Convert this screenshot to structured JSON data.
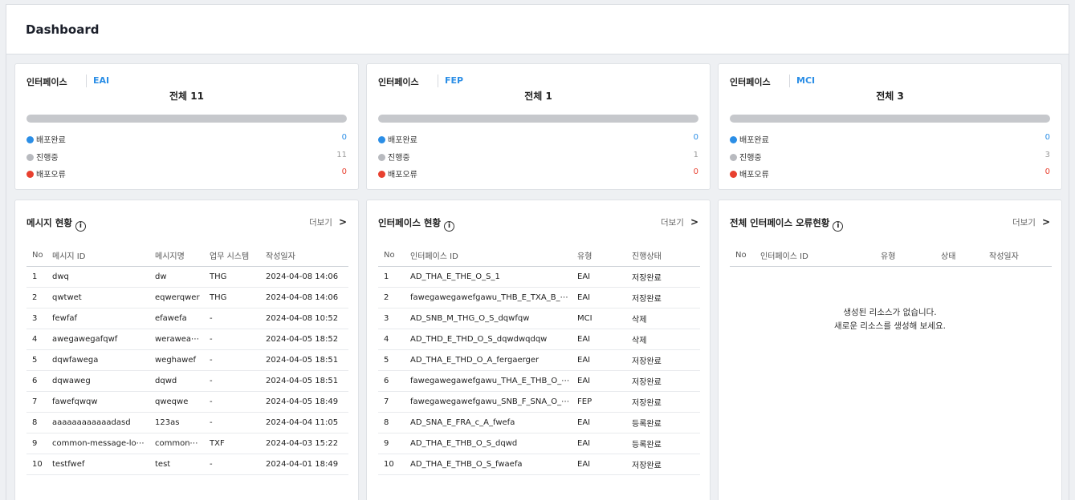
{
  "header": {
    "title": "Dashboard"
  },
  "summary_cards": [
    {
      "label": "인터페이스",
      "type": "EAI",
      "total": "전체 11",
      "rows": [
        {
          "label": "배포완료",
          "value": "0"
        },
        {
          "label": "진행중",
          "value": "11"
        },
        {
          "label": "배포오류",
          "value": "0"
        }
      ]
    },
    {
      "label": "인터페이스",
      "type": "FEP",
      "total": "전체 1",
      "rows": [
        {
          "label": "배포완료",
          "value": "0"
        },
        {
          "label": "진행중",
          "value": "1"
        },
        {
          "label": "배포오류",
          "value": "0"
        }
      ]
    },
    {
      "label": "인터페이스",
      "type": "MCI",
      "total": "전체 3",
      "rows": [
        {
          "label": "배포완료",
          "value": "0"
        },
        {
          "label": "진행중",
          "value": "3"
        },
        {
          "label": "배포오류",
          "value": "0"
        }
      ]
    }
  ],
  "colors": {
    "accent": "#2b8ee6",
    "progress": "#b8babf",
    "error": "#e8402f"
  },
  "message_panel": {
    "title": "메시지 현황",
    "more": "더보기",
    "columns": [
      "No",
      "메시지 ID",
      "메시지명",
      "업무 시스템",
      "작성일자"
    ],
    "rows": [
      [
        "1",
        "dwq",
        "dw",
        "THG",
        "2024-04-08 14:06"
      ],
      [
        "2",
        "qwtwet",
        "eqwerqwer",
        "THG",
        "2024-04-08 14:06"
      ],
      [
        "3",
        "fewfaf",
        "efawefa",
        "-",
        "2024-04-08 10:52"
      ],
      [
        "4",
        "awegawegafqwf",
        "werawea⋯",
        "-",
        "2024-04-05 18:52"
      ],
      [
        "5",
        "dqwfawega",
        "weghawef",
        "-",
        "2024-04-05 18:51"
      ],
      [
        "6",
        "dqwaweg",
        "dqwd",
        "-",
        "2024-04-05 18:51"
      ],
      [
        "7",
        "fawefqwqw",
        "qweqwe",
        "-",
        "2024-04-05 18:49"
      ],
      [
        "8",
        "aaaaaaaaaaaadasd",
        "123as",
        "-",
        "2024-04-04 11:05"
      ],
      [
        "9",
        "common-message-lo⋯",
        "common⋯",
        "TXF",
        "2024-04-03 15:22"
      ],
      [
        "10",
        "testfwef",
        "test",
        "-",
        "2024-04-01 18:49"
      ]
    ]
  },
  "interface_panel": {
    "title": "인터페이스 현황",
    "more": "더보기",
    "columns": [
      "No",
      "인터페이스 ID",
      "유형",
      "진행상태"
    ],
    "rows": [
      [
        "1",
        "AD_THA_E_THE_O_S_1",
        "EAI",
        "저장완료"
      ],
      [
        "2",
        "fawegawegawefgawu_THB_E_TXA_B_⋯",
        "EAI",
        "저장완료"
      ],
      [
        "3",
        "AD_SNB_M_THG_O_S_dqwfqw",
        "MCI",
        "삭제"
      ],
      [
        "4",
        "AD_THD_E_THD_O_S_dqwdwqdqw",
        "EAI",
        "삭제"
      ],
      [
        "5",
        "AD_THA_E_THD_O_A_fergaerger",
        "EAI",
        "저장완료"
      ],
      [
        "6",
        "fawegawegawefgawu_THA_E_THB_O_⋯",
        "EAI",
        "저장완료"
      ],
      [
        "7",
        "fawegawegawefgawu_SNB_F_SNA_O_⋯",
        "FEP",
        "저장완료"
      ],
      [
        "8",
        "AD_SNA_E_FRA_c_A_fwefa",
        "EAI",
        "등록완료"
      ],
      [
        "9",
        "AD_THA_E_THB_O_S_dqwd",
        "EAI",
        "등록완료"
      ],
      [
        "10",
        "AD_THA_E_THB_O_S_fwaefa",
        "EAI",
        "저장완료"
      ]
    ]
  },
  "error_panel": {
    "title": "전체 인터페이스 오류현황",
    "more": "더보기",
    "columns": [
      "No",
      "인터페이스 ID",
      "유형",
      "상태",
      "작성일자"
    ],
    "empty_line1": "생성된 리소스가 없습니다.",
    "empty_line2": "새로운 리소스를 생성해 보세요."
  }
}
